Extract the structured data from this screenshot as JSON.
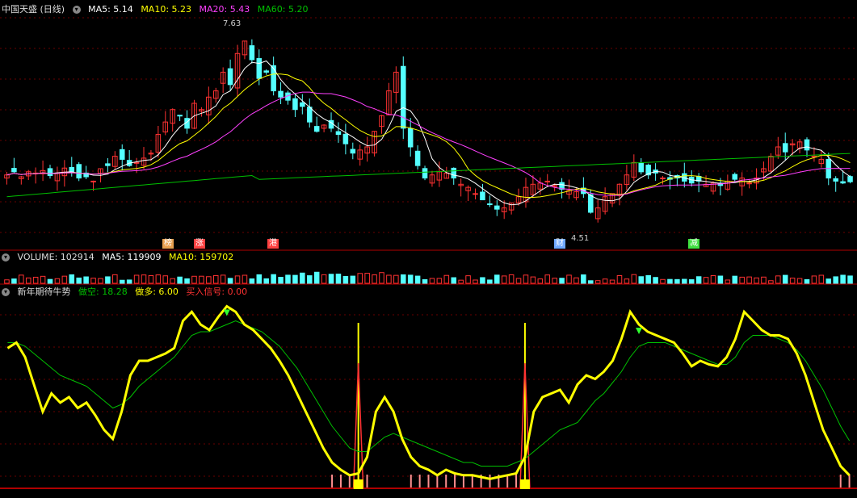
{
  "main_header": {
    "stock": "中国天盛 (日线)",
    "ma5": "MA5: 5.14",
    "ma10": "MA10: 5.23",
    "ma20": "MA20: 5.43",
    "ma60": "MA60: 5.20"
  },
  "volume_header": {
    "title": "VOLUME: 102914",
    "ma5": "MA5: 119909",
    "ma10": "MA10: 159702"
  },
  "indicator_header": {
    "title": "新年期待牛势",
    "short": "做空: 18.28",
    "long": "做多: 6.00",
    "buy": "买入信号: 0.00"
  },
  "annotations": {
    "high": "7.63",
    "low": "4.51"
  },
  "event_tags": [
    {
      "label": "榜",
      "color": "#e8a050"
    },
    {
      "label": "涨",
      "color": "#ff4040"
    },
    {
      "label": "港",
      "color": "#ff4040"
    },
    {
      "label": "财",
      "color": "#6fa8ff"
    },
    {
      "label": "减",
      "color": "#40e040"
    }
  ],
  "colors": {
    "up": "#ff3232",
    "down": "#54ffff",
    "ma5": "#ffffff",
    "ma10": "#ffff00",
    "ma20": "#ff40ff",
    "ma60": "#00c000",
    "indicator_main": "#ffff00",
    "indicator_signal": "#00c000",
    "divider": "#b00000"
  },
  "chart_data": [
    {
      "type": "candlestick",
      "title": "中国天盛 (日线)",
      "ylim": [
        4.3,
        7.8
      ],
      "closes": [
        5.25,
        5.3,
        5.22,
        5.3,
        5.28,
        5.32,
        5.24,
        5.28,
        5.36,
        5.3,
        5.2,
        5.22,
        5.15,
        5.35,
        5.4,
        5.55,
        5.5,
        5.4,
        5.45,
        5.52,
        5.6,
        5.9,
        6.1,
        6.3,
        6.2,
        6.0,
        6.4,
        6.3,
        6.5,
        6.6,
        6.9,
        6.7,
        7.2,
        7.4,
        7.1,
        6.8,
        6.9,
        6.6,
        6.5,
        6.45,
        6.3,
        6.35,
        6.1,
        5.95,
        6.05,
        6.0,
        5.9,
        5.75,
        5.6,
        5.65,
        5.7,
        5.95,
        6.2,
        6.6,
        6.9,
        6.0,
        5.7,
        5.4,
        5.2,
        5.25,
        5.3,
        5.28,
        5.2,
        5.1,
        5.05,
        4.95,
        4.85,
        4.78,
        4.7,
        4.72,
        4.8,
        4.9,
        5.05,
        5.1,
        5.12,
        5.15,
        5.08,
        5.02,
        5.0,
        4.98,
        4.95,
        4.65,
        4.72,
        4.9,
        4.95,
        5.1,
        5.25,
        5.45,
        5.3,
        5.25,
        5.28,
        5.2,
        5.18,
        5.2,
        5.15,
        5.12,
        5.15,
        5.1,
        5.12,
        5.08,
        5.15,
        5.18,
        5.2,
        5.12,
        5.2,
        5.35,
        5.55,
        5.7,
        5.62,
        5.75,
        5.78,
        5.65,
        5.55,
        5.5,
        5.2,
        5.15,
        5.12,
        5.14
      ]
    },
    {
      "type": "bar",
      "title": "VOLUME",
      "values": [
        102914
      ]
    },
    {
      "type": "line",
      "title": "新年期待牛势",
      "ylim": [
        0,
        100
      ],
      "series": [
        {
          "name": "做空",
          "values": [
            75,
            78,
            70,
            55,
            40,
            50,
            45,
            48,
            42,
            45,
            38,
            30,
            25,
            40,
            60,
            68,
            68,
            70,
            72,
            75,
            90,
            95,
            88,
            85,
            92,
            98,
            95,
            88,
            85,
            80,
            75,
            68,
            60,
            50,
            40,
            30,
            20,
            12,
            8,
            5,
            6,
            15,
            40,
            48,
            40,
            25,
            15,
            10,
            8,
            5,
            8,
            6,
            5,
            5,
            4,
            3,
            4,
            5,
            6,
            15,
            40,
            48,
            50,
            52,
            45,
            55,
            60,
            58,
            62,
            68,
            80,
            95,
            88,
            84,
            82,
            80,
            78,
            72,
            65,
            68,
            66,
            65,
            70,
            80,
            95,
            90,
            85,
            82,
            82,
            80,
            72,
            60,
            45,
            30,
            20,
            10,
            5
          ]
        },
        {
          "name": "做多",
          "values": [
            78,
            78,
            76,
            72,
            68,
            64,
            60,
            58,
            56,
            54,
            50,
            46,
            42,
            44,
            48,
            54,
            58,
            62,
            66,
            70,
            76,
            82,
            84,
            84,
            86,
            88,
            90,
            88,
            86,
            84,
            80,
            76,
            70,
            64,
            56,
            48,
            40,
            32,
            26,
            20,
            18,
            18,
            22,
            26,
            28,
            26,
            24,
            22,
            20,
            18,
            16,
            14,
            12,
            12,
            10,
            10,
            10,
            10,
            12,
            14,
            18,
            22,
            26,
            30,
            32,
            34,
            40,
            46,
            50,
            56,
            62,
            70,
            76,
            78,
            78,
            78,
            76,
            74,
            72,
            70,
            68,
            66,
            66,
            70,
            78,
            82,
            82,
            82,
            80,
            78,
            74,
            68,
            60,
            52,
            42,
            32,
            24
          ]
        },
        {
          "name": "买入信号",
          "values": [
            0
          ]
        }
      ]
    }
  ]
}
